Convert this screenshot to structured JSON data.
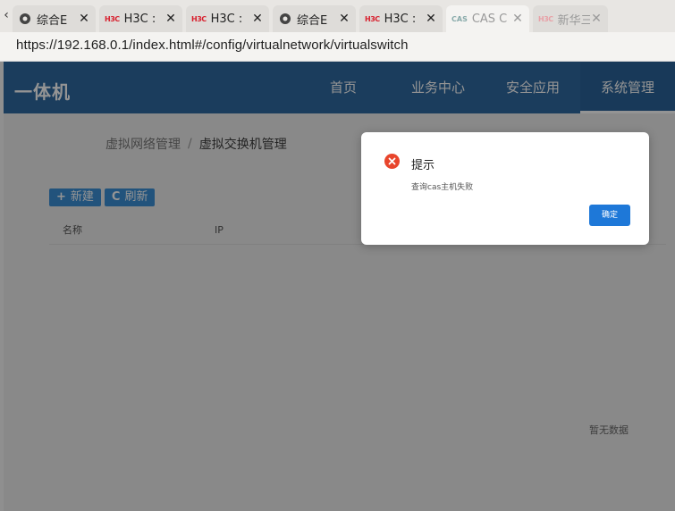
{
  "browser": {
    "tabs": [
      {
        "icon": "globe-icon",
        "title": "综合E",
        "active": false,
        "faded": false
      },
      {
        "icon": "h3c-logo-icon",
        "logo_text": "H3C",
        "title": "H3C :",
        "active": false,
        "faded": false
      },
      {
        "icon": "h3c-logo-icon",
        "logo_text": "H3C",
        "title": "H3C :",
        "active": false,
        "faded": false
      },
      {
        "icon": "globe-icon",
        "title": "综合E",
        "active": false,
        "faded": false
      },
      {
        "icon": "h3c-logo-icon",
        "logo_text": "H3C",
        "title": "H3C :",
        "active": false,
        "faded": false
      },
      {
        "icon": "cas-logo-icon",
        "logo_text": "CAS",
        "title": "CAS C",
        "active": true,
        "faded": true
      },
      {
        "icon": "h3c-logo-icon",
        "logo_text": "H3C",
        "title": "新华三",
        "active": false,
        "faded": true
      }
    ],
    "url": "https://192.168.0.1/index.html#/config/virtualnetwork/virtualswitch"
  },
  "app": {
    "brand": "一体机",
    "nav": [
      {
        "label": "首页",
        "active": false
      },
      {
        "label": "业务中心",
        "active": false
      },
      {
        "label": "安全应用",
        "active": false
      },
      {
        "label": "系统管理",
        "active": true
      }
    ],
    "breadcrumb": {
      "items": [
        "虚拟网络管理",
        "虚拟交换机管理"
      ],
      "separator": "/"
    },
    "toolbar": {
      "new_label": "新建",
      "refresh_label": "刷新"
    },
    "table": {
      "columns": [
        "名称",
        "IP"
      ],
      "empty_text": "暂无数据"
    }
  },
  "dialog": {
    "title": "提示",
    "message": "查询cas主机失败",
    "ok_label": "确定",
    "icon": "error-circle-icon",
    "icon_color": "#e8452c"
  },
  "colors": {
    "header": "#2f6aa1",
    "primary_button": "#1e78d8",
    "error": "#e8452c"
  }
}
